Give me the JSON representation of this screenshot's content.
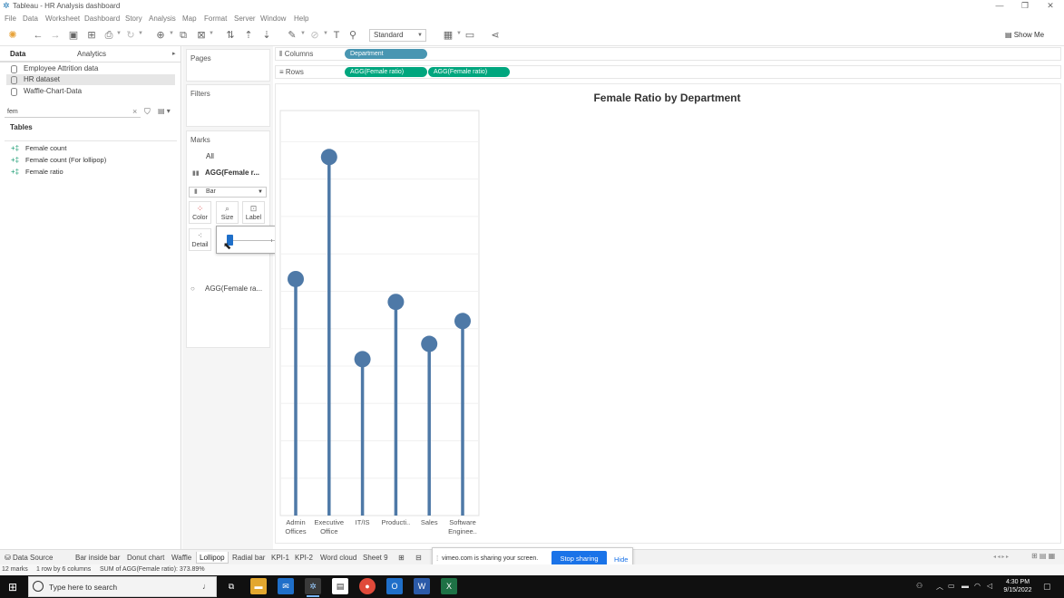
{
  "window": {
    "title": "Tableau - HR Analysis dashboard",
    "controls": [
      "—",
      "❐",
      "✕"
    ]
  },
  "menu": [
    "File",
    "Data",
    "Worksheet",
    "Dashboard",
    "Story",
    "Analysis",
    "Map",
    "Format",
    "Server",
    "Window",
    "Help"
  ],
  "toolbar": {
    "fit_label": "Standard",
    "show_me": "Show Me"
  },
  "data_pane": {
    "tabs": [
      "Data",
      "Analytics"
    ],
    "datasources": [
      {
        "label": "Employee Attrition data",
        "selected": false
      },
      {
        "label": "HR dataset",
        "selected": true
      },
      {
        "label": "Waffle-Chart-Data",
        "selected": false
      }
    ],
    "search_value": "fem",
    "tables_heading": "Tables",
    "fields": [
      "Female count",
      "Female count (For lollipop)",
      "Female ratio"
    ]
  },
  "cards": {
    "pages": "Pages",
    "filters": "Filters",
    "marks": "Marks",
    "marks_all": "All",
    "marks_measure_1": "AGG(Female r...",
    "mark_type": "Bar",
    "buttons": [
      "Color",
      "Size",
      "Label",
      "Detail"
    ],
    "marks_measure_2": "AGG(Female ra..."
  },
  "shelves": {
    "columns_label": "Columns",
    "columns_pills": [
      "Department"
    ],
    "rows_label": "Rows",
    "rows_pills": [
      "AGG(Female ratio)",
      "AGG(Female ratio)"
    ]
  },
  "colors": {
    "accent_blue": "#4e79a7",
    "pill_blue": "#4996b2",
    "pill_green": "#00a67e",
    "lollipop": "#4e79a7"
  },
  "chart_data": {
    "type": "lollipop",
    "title": "Female Ratio by Department",
    "categories": [
      [
        "Admin",
        "Offices"
      ],
      [
        "Executive",
        "Office"
      ],
      [
        "IT/IS"
      ],
      [
        "Producti.."
      ],
      [
        "Sales"
      ],
      [
        "Software",
        "Enginee.."
      ]
    ],
    "values": [
      0.62,
      0.94,
      0.41,
      0.56,
      0.45,
      0.51
    ],
    "ylim": [
      0,
      1.0
    ]
  },
  "sheets": {
    "data_source": "Data Source",
    "tabs": [
      "Bar inside bar",
      "Donut chart",
      "Waffle",
      "Lollipop",
      "Radial bar",
      "KPI-1",
      "KPI-2",
      "Word cloud",
      "Sheet 9"
    ],
    "active": "Lollipop"
  },
  "share": {
    "text": "vimeo.com is sharing your screen.",
    "stop": "Stop sharing",
    "hide": "Hide"
  },
  "status": {
    "marks": "12 marks",
    "rows_cols": "1 row by 6 columns",
    "sum": "SUM of AGG(Female ratio): 373.89%"
  },
  "taskbar": {
    "search_placeholder": "Type here to search",
    "time": "4:30 PM",
    "date": "9/15/2022"
  }
}
